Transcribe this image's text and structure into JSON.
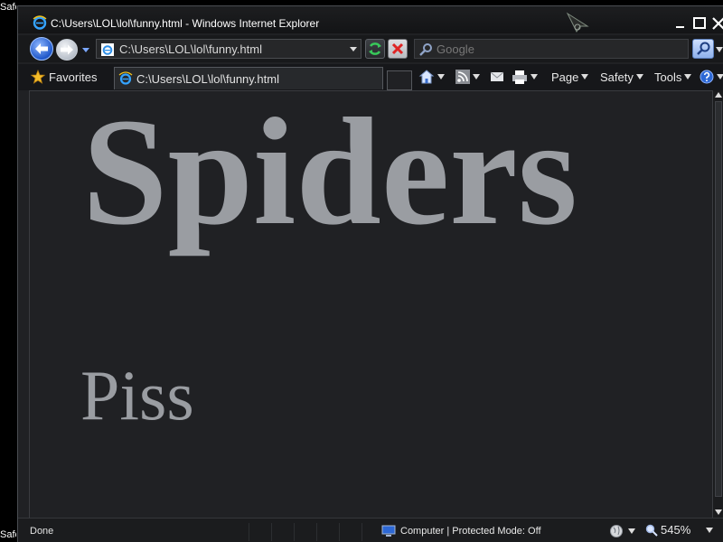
{
  "edge": {
    "top_text": "Safe",
    "bottom_text": "Safe"
  },
  "window": {
    "title": "C:\\Users\\LOL\\lol\\funny.html - Windows Internet Explorer"
  },
  "navigation": {
    "address": "C:\\Users\\LOL\\lol\\funny.html",
    "search_placeholder": "Google"
  },
  "command_bar": {
    "favorites_label": "Favorites",
    "tab_title": "C:\\Users\\LOL\\lol\\funny.html",
    "page_label": "Page",
    "safety_label": "Safety",
    "tools_label": "Tools"
  },
  "content": {
    "heading": "Spiders",
    "text": "Piss"
  },
  "status_bar": {
    "status": "Done",
    "zone": "Computer | Protected Mode: Off",
    "zoom": "545%"
  },
  "icons": {
    "browser": "ie-logo-icon",
    "back": "back-arrow-icon",
    "forward": "forward-arrow-icon",
    "refresh": "refresh-icon",
    "stop": "stop-icon",
    "search": "magnifier-icon",
    "favorites": "star-icon",
    "home": "home-icon",
    "feeds": "rss-icon",
    "mail": "mail-icon",
    "print": "printer-icon",
    "help": "help-icon",
    "zone": "computer-icon",
    "zoom": "zoom-icon"
  },
  "colors": {
    "content_background": "#202124",
    "content_text": "#9a9da2",
    "chrome_background": "#16171a",
    "accent_blue": "#1f57c9"
  }
}
